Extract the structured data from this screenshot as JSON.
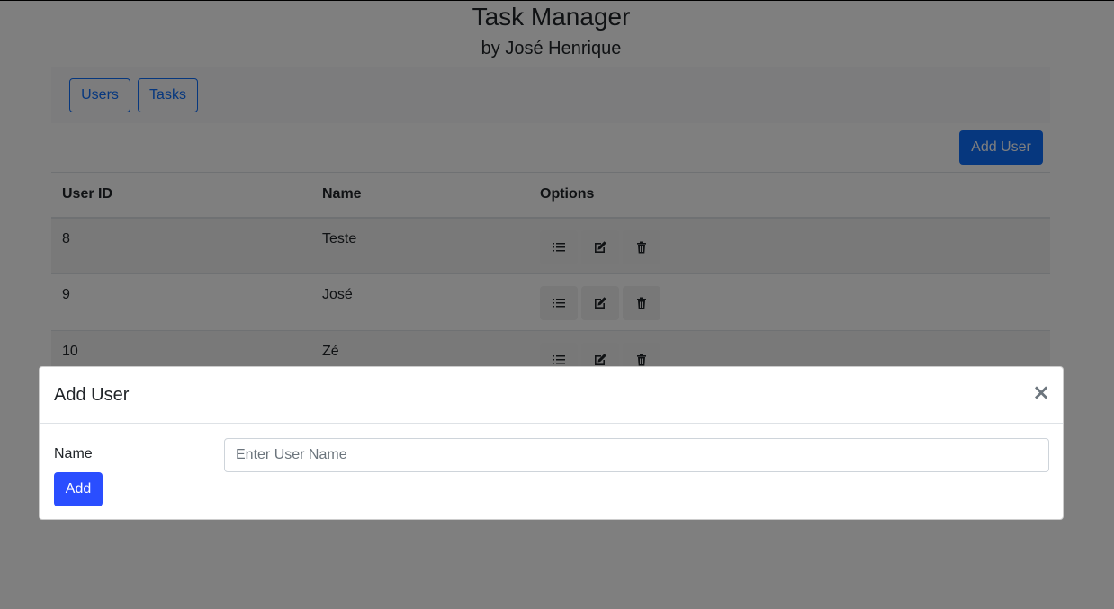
{
  "header": {
    "title": "Task Manager",
    "subtitle": "by José Henrique"
  },
  "nav": {
    "users_label": "Users",
    "tasks_label": "Tasks"
  },
  "toolbar": {
    "add_user_label": "Add User"
  },
  "table": {
    "columns": [
      "User ID",
      "Name",
      "Options"
    ],
    "rows": [
      {
        "id": "8",
        "name": "Teste"
      },
      {
        "id": "9",
        "name": "José"
      },
      {
        "id": "10",
        "name": "Zé"
      }
    ],
    "option_icons": [
      "list-icon",
      "edit-icon",
      "trash-icon"
    ]
  },
  "modal": {
    "title": "Add User",
    "close_glyph": "×",
    "name_label": "Name",
    "name_placeholder": "Enter User Name",
    "name_value": "",
    "add_label": "Add"
  },
  "colors": {
    "primary": "#0d6efd",
    "modal_add": "#2a4eff",
    "backdrop": "rgba(0,0,0,0.5)"
  }
}
